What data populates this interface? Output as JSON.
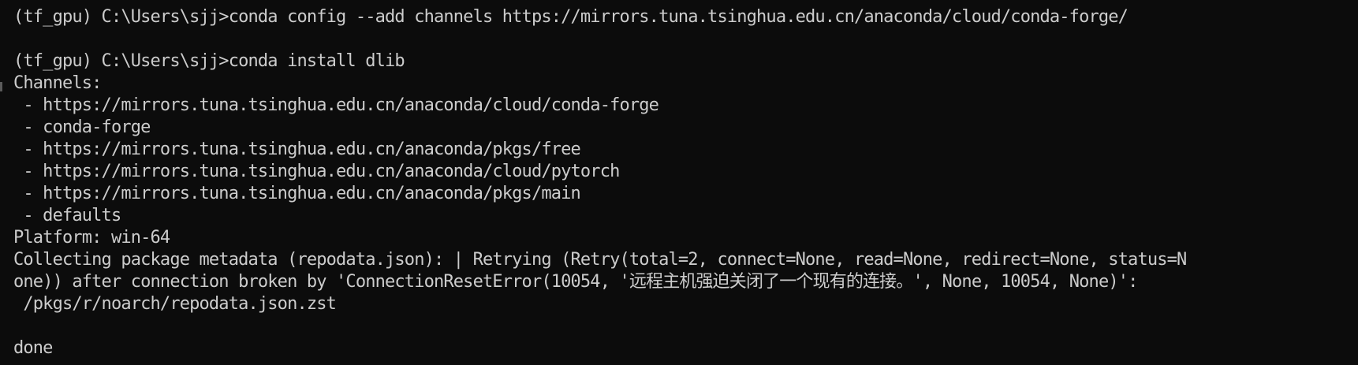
{
  "terminal": {
    "lines": [
      "(tf_gpu) C:\\Users\\sjj>conda config --add channels https://mirrors.tuna.tsinghua.edu.cn/anaconda/cloud/conda-forge/",
      "",
      "(tf_gpu) C:\\Users\\sjj>conda install dlib",
      "Channels:",
      " - https://mirrors.tuna.tsinghua.edu.cn/anaconda/cloud/conda-forge",
      " - conda-forge",
      " - https://mirrors.tuna.tsinghua.edu.cn/anaconda/pkgs/free",
      " - https://mirrors.tuna.tsinghua.edu.cn/anaconda/cloud/pytorch",
      " - https://mirrors.tuna.tsinghua.edu.cn/anaconda/pkgs/main",
      " - defaults",
      "Platform: win-64",
      "Collecting package metadata (repodata.json): | Retrying (Retry(total=2, connect=None, read=None, redirect=None, status=N",
      "one)) after connection broken by 'ConnectionResetError(10054, '远程主机强迫关闭了一个现有的连接。', None, 10054, None)':",
      " /pkgs/r/noarch/repodata.json.zst",
      "",
      "done"
    ]
  },
  "colors": {
    "background": "#0c0c0c",
    "foreground": "#cccccc"
  }
}
